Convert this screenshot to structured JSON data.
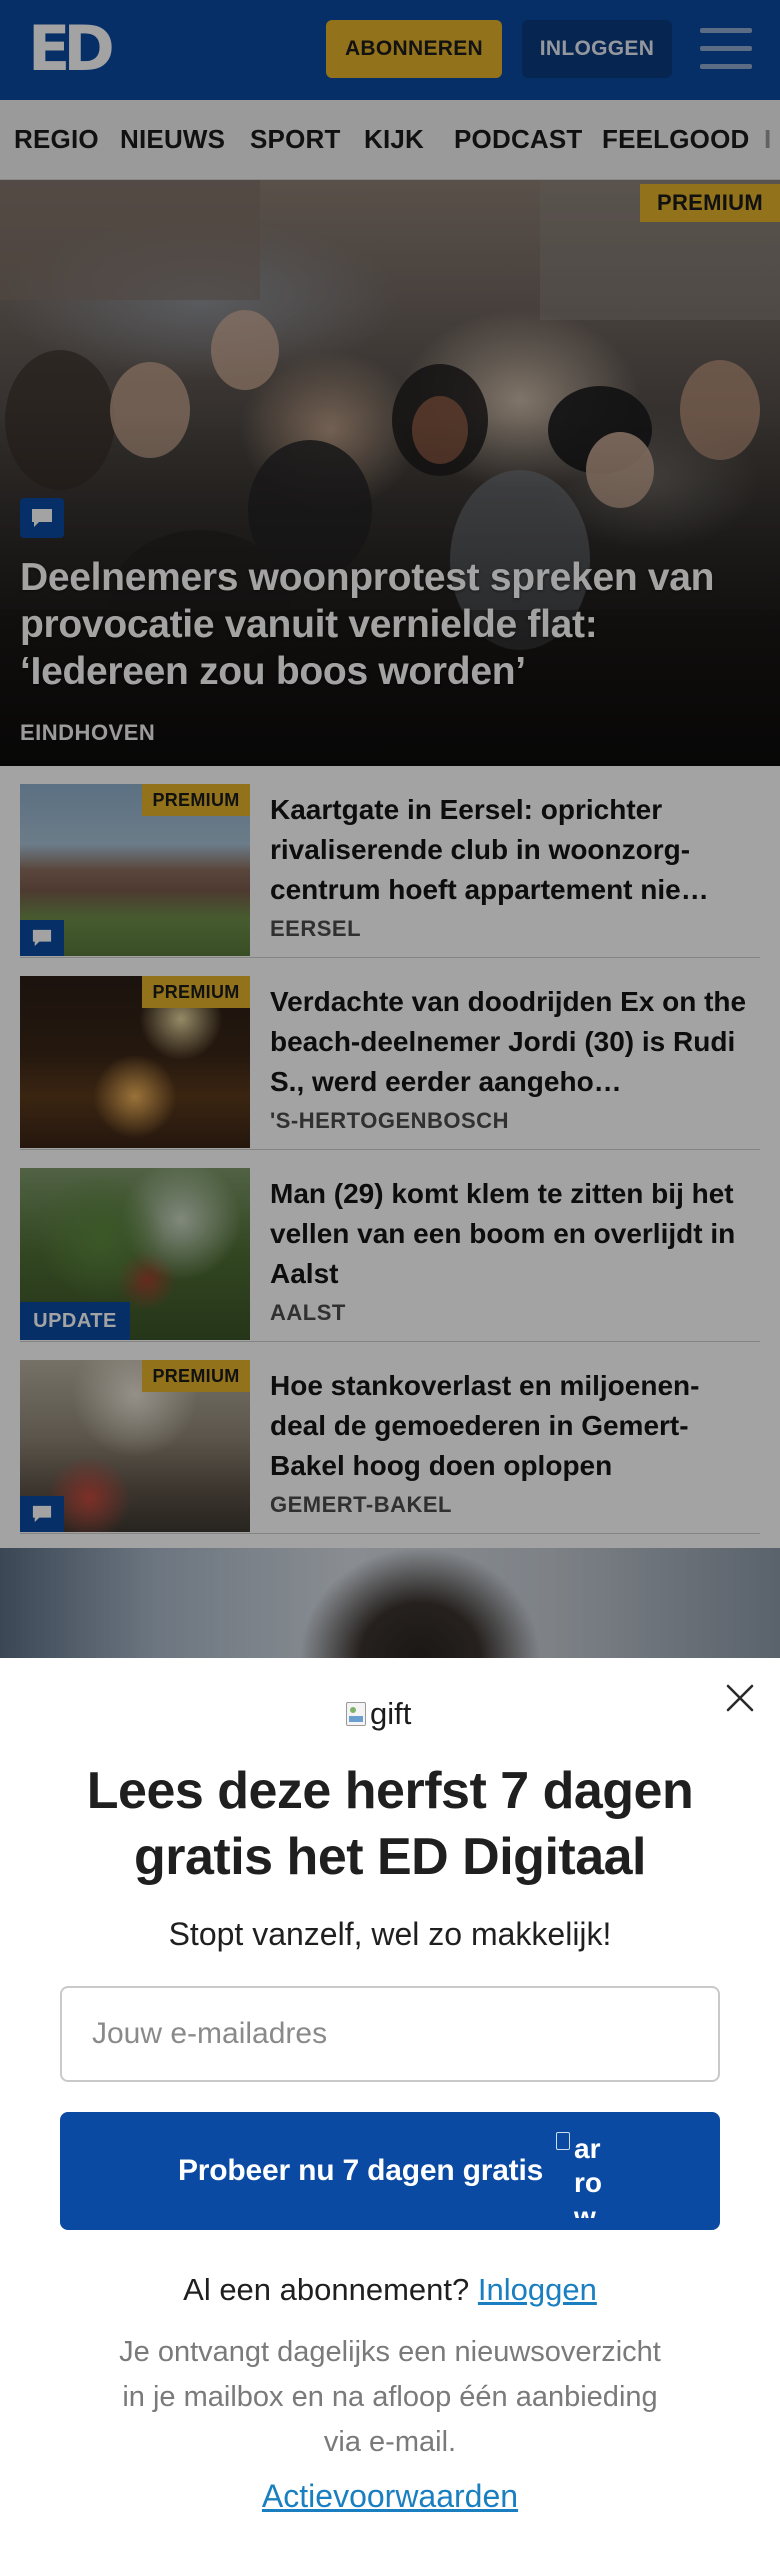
{
  "header": {
    "logo": "ED",
    "subscribe_label": "ABONNEREN",
    "login_label": "INLOGGEN",
    "colors": {
      "brand_blue": "#0b4aa2",
      "accent_yellow": "#e4b229"
    }
  },
  "nav": {
    "items": [
      "REGIO",
      "NIEUWS",
      "SPORT",
      "KIJK",
      "PODCAST",
      "FEELGOOD",
      "I"
    ]
  },
  "hero": {
    "badge": "PREMIUM",
    "title": "Deelnemers woonprotest spreken van provocatie vanuit vernielde flat: ‘Iedereen zou boos worden’",
    "region": "EINDHOVEN",
    "icons": [
      "comment-icon"
    ]
  },
  "articles": [
    {
      "badge": "PREMIUM",
      "title": "Kaartgate in Eersel: oprichter rivaliserende club in woonzorg-centrum hoeft appartement nie…",
      "region": "EERSEL",
      "has_comments": true
    },
    {
      "badge": "PREMIUM",
      "title": "Verdachte van doodrijden Ex on the beach-deelnemer Jordi (30) is Rudi S., werd eerder aangeho…",
      "region": "'S-HERTOGENBOSCH",
      "has_comments": false
    },
    {
      "badge": "UPDATE",
      "title": "Man (29) komt klem te zitten bij het vellen van een boom en overlijdt in Aalst",
      "region": "AALST",
      "has_comments": false
    },
    {
      "badge": "PREMIUM",
      "title": "Hoe stankoverlast en miljoenen-deal de gemoederen in Gemert-Bakel hoog doen oplopen",
      "region": "GEMERT-BAKEL",
      "has_comments": true
    }
  ],
  "modal": {
    "gift_alt": "gift",
    "title": "Lees deze herfst 7 dagen gratis het ED Digitaal",
    "subtitle": "Stopt vanzelf, wel zo makkelijk!",
    "email_placeholder": "Jouw e-mailadres",
    "cta_label": "Probeer nu 7 dagen gratis",
    "cta_icon_alt": "arrow right",
    "login_prompt": "Al een abonnement?",
    "login_link": "Inloggen",
    "info": "Je ontvangt dagelijks een nieuwsoverzicht in je mailbox en na afloop één aanbieding via e-mail.",
    "terms_link": "Actievoorwaarden",
    "icons": [
      "close-icon",
      "gift-icon",
      "arrow-right-icon"
    ]
  }
}
